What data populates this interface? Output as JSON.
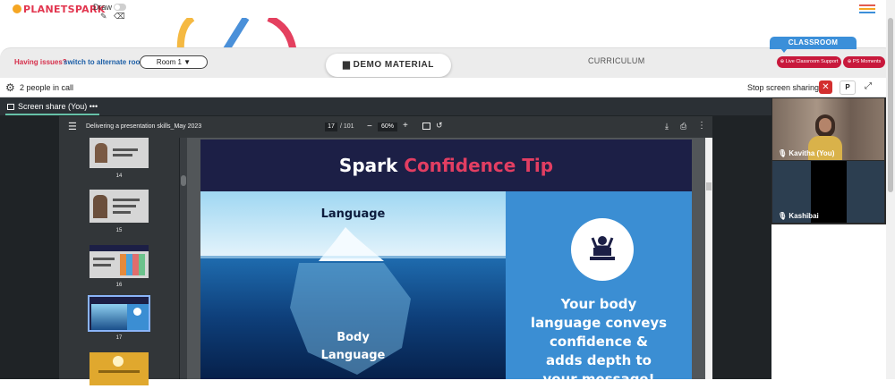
{
  "app": {
    "logo_text": "PLANETSPARK",
    "draw_label": "Draw",
    "icons": [
      "pencil-icon",
      "eraser-icon",
      "hamburger-icon"
    ]
  },
  "controls": {
    "issues_text": "Having issues?",
    "alt_room_link": "switch to alternate room",
    "room_select": "Room 1 ▼",
    "demo_material": "DEMO MATERIAL",
    "curriculum": "CURRICULUM",
    "classroom_tab": "CLASSROOM",
    "live_support": "Live Classroom Support",
    "ps_moments": "PS Moments"
  },
  "call": {
    "people_count": "2 people in call",
    "stop_sharing": "Stop screen sharing",
    "p_button": "P",
    "share_tab": "Screen share (You)",
    "share_tab_menu": "•••"
  },
  "pdf": {
    "title": "Delivering a presentation skills_May 2023",
    "page_current": "17",
    "page_total": "/ 101",
    "zoom": "60%",
    "thumbnails": [
      {
        "num": "14"
      },
      {
        "num": "15"
      },
      {
        "num": "16"
      },
      {
        "num": "17"
      }
    ]
  },
  "slide": {
    "title_part1": "Spark ",
    "title_part2": "Confidence Tip",
    "iceberg_top_label": "Language",
    "iceberg_bottom_label_1": "Body",
    "iceberg_bottom_label_2": "Language",
    "tip_line1": "Your body",
    "tip_line2": "language conveys",
    "tip_line3": "confidence &",
    "tip_line4": "adds depth to",
    "tip_line5": "your message!"
  },
  "participants": [
    {
      "name": "Kavitha (You)"
    },
    {
      "name": "Kashibai"
    }
  ],
  "colors": {
    "brand_red": "#e2364f",
    "classroom_blue": "#3b8fd9",
    "support_red": "#c8193c",
    "slide_navy": "#1c1f46",
    "slide_accent": "#e23e62",
    "tip_blue": "#3b8ed3"
  }
}
